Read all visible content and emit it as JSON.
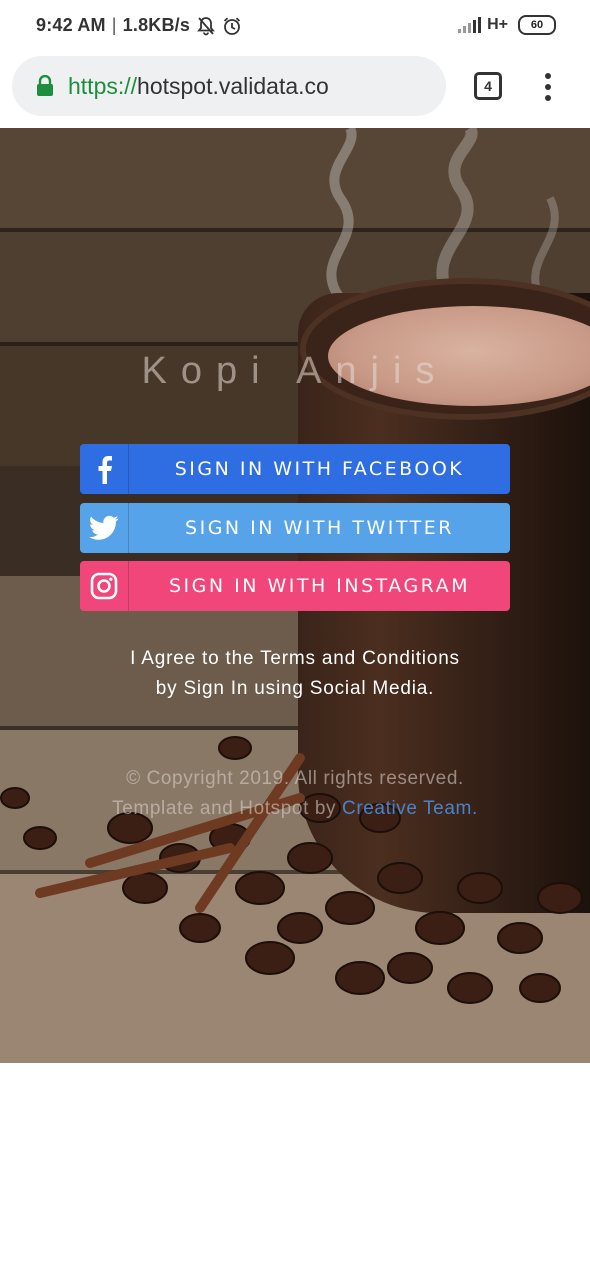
{
  "status_bar": {
    "time": "9:42 AM",
    "separator": "|",
    "speed": "1.8KB/s",
    "network": "H+",
    "battery": "60",
    "icons": [
      "bell-off-icon",
      "alarm-icon",
      "signal-icon"
    ]
  },
  "browser": {
    "url_scheme": "https://",
    "url_host": "hotspot.validata.co",
    "tab_count": "4",
    "icons": [
      "lock-icon",
      "tabs-icon",
      "menu-icon"
    ]
  },
  "hero": {
    "brand": "Kopi Anjis",
    "buttons": {
      "facebook": "SIGN IN WITH FACEBOOK",
      "twitter": "SIGN IN WITH TWITTER",
      "instagram": "SIGN IN WITH INSTAGRAM"
    },
    "colors": {
      "facebook": "#2f6de3",
      "twitter": "#56a3ea",
      "instagram": "#f0467a",
      "link": "#4a82c9"
    },
    "agree_line1": "I Agree to the Terms and Conditions",
    "agree_line2": "by Sign In using Social Media.",
    "copyright_line1": "© Copyright 2019. All rights reserved.",
    "copyright_line2_prefix": "Template and Hotspot by ",
    "copyright_team": "Creative Team",
    "copyright_suffix": "."
  }
}
